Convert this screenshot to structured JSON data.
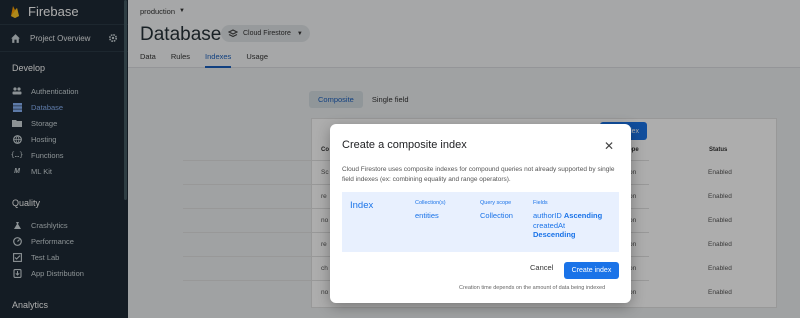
{
  "app": {
    "name": "Firebase",
    "project_overview": "Project Overview"
  },
  "sidebar": {
    "sections": [
      {
        "title": "Develop",
        "items": [
          {
            "label": "Authentication",
            "icon": "people-icon"
          },
          {
            "label": "Database",
            "icon": "database-icon",
            "active": true
          },
          {
            "label": "Storage",
            "icon": "folder-icon"
          },
          {
            "label": "Hosting",
            "icon": "globe-icon"
          },
          {
            "label": "Functions",
            "icon": "braces-icon"
          },
          {
            "label": "ML Kit",
            "icon": "ml-icon"
          }
        ]
      },
      {
        "title": "Quality",
        "items": [
          {
            "label": "Crashlytics",
            "icon": "crash-icon"
          },
          {
            "label": "Performance",
            "icon": "gauge-icon"
          },
          {
            "label": "Test Lab",
            "icon": "checklist-icon"
          },
          {
            "label": "App Distribution",
            "icon": "distribution-icon"
          }
        ]
      },
      {
        "title": "Analytics",
        "items": []
      }
    ]
  },
  "topbar": {
    "project": "production"
  },
  "header": {
    "title": "Database",
    "db_selector": "Cloud Firestore"
  },
  "tabs": [
    "Data",
    "Rules",
    "Indexes",
    "Usage"
  ],
  "active_tab": "Indexes",
  "subtabs": [
    "Composite",
    "Single field"
  ],
  "add_index_label": "Add index",
  "table": {
    "headers": {
      "collection": "Co",
      "scope": "ope",
      "status": "Status"
    },
    "rows": [
      {
        "collection": "Sc",
        "scope": "on",
        "status": "Enabled"
      },
      {
        "collection": "re",
        "scope": "on",
        "status": "Enabled"
      },
      {
        "collection": "no",
        "scope": "on",
        "status": "Enabled"
      },
      {
        "collection": "re",
        "scope": "on",
        "status": "Enabled"
      },
      {
        "collection": "ch",
        "scope": "on",
        "status": "Enabled"
      },
      {
        "collection": "no",
        "scope": "on",
        "status": "Enabled"
      }
    ]
  },
  "dialog": {
    "title": "Create a composite index",
    "description": "Cloud Firestore uses composite indexes for compound queries not already supported by single field indexes (ex: combining equality and range operators).",
    "index_label": "Index",
    "collection_label": "Collection(s)",
    "collection_value": "entities",
    "scope_label": "Query scope",
    "scope_value": "Collection",
    "fields_label": "Fields",
    "fields": [
      {
        "name": "authorID",
        "direction": "Ascending"
      },
      {
        "name": "createdAt",
        "direction": "Descending"
      }
    ],
    "cancel_label": "Cancel",
    "create_label": "Create index",
    "footnote": "Creation time depends on the amount of data being indexed"
  },
  "colors": {
    "accent": "#1a73e8",
    "sidebar_bg": "#1e2a35",
    "highlight_bg": "#e8f0fe"
  }
}
